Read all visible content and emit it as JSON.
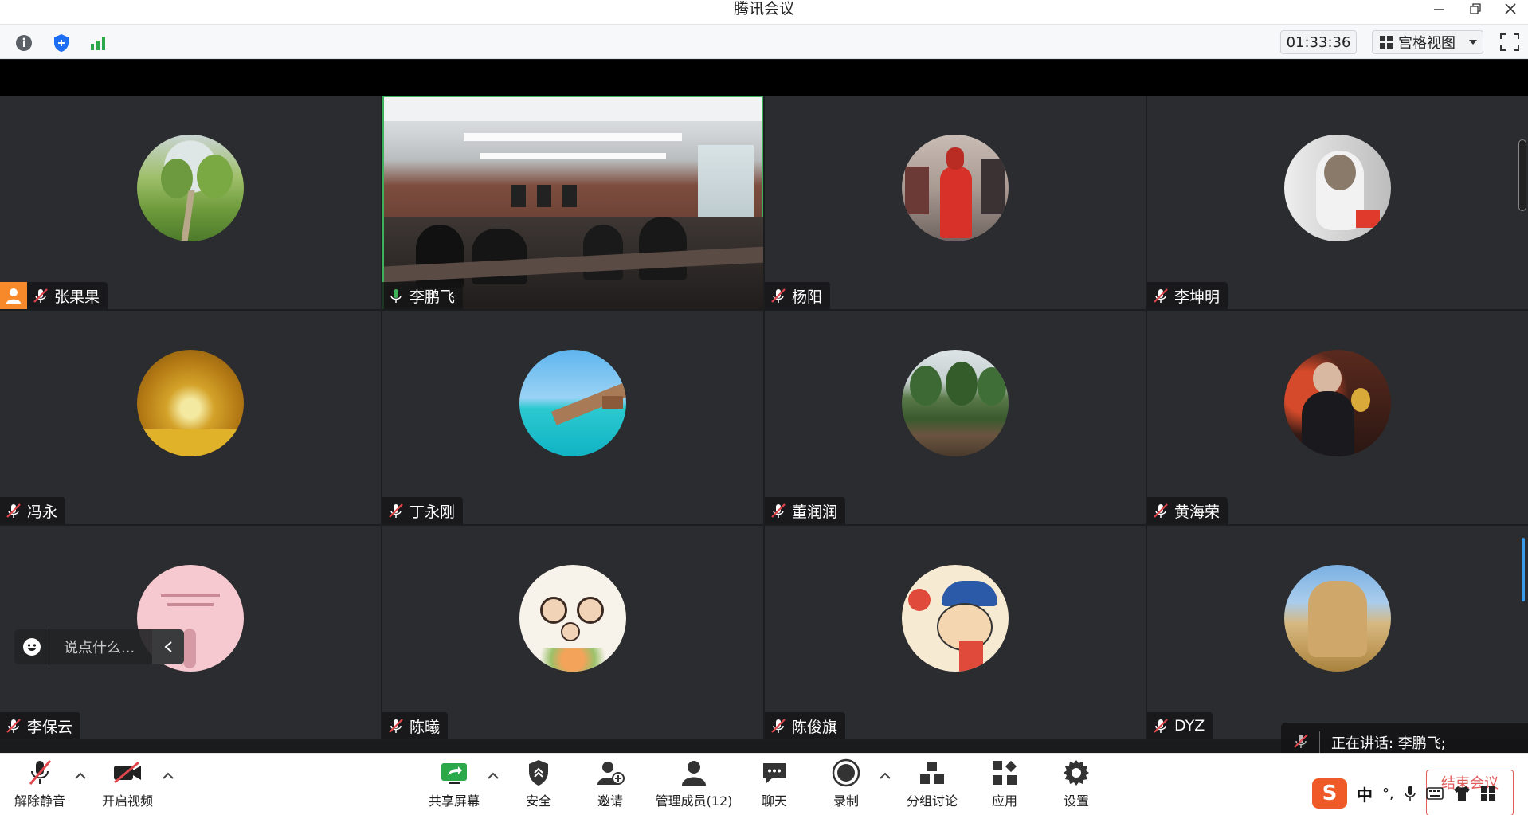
{
  "window": {
    "title": "腾讯会议"
  },
  "toolbar": {
    "timer": "01:33:36",
    "view_mode": "宫格视图"
  },
  "participants": [
    {
      "name": "张果果",
      "mic": "muted",
      "host": true,
      "avatar": "green-trail-photo"
    },
    {
      "name": "李鹏飞",
      "mic": "active",
      "video": true,
      "avatar": "conference-room-video"
    },
    {
      "name": "杨阳",
      "mic": "muted",
      "avatar": "red-jacket-photo"
    },
    {
      "name": "李坤明",
      "mic": "muted",
      "avatar": "cat-photo"
    },
    {
      "name": "冯永",
      "mic": "muted",
      "avatar": "golden-trees-photo"
    },
    {
      "name": "丁永刚",
      "mic": "muted",
      "avatar": "pier-sea-photo"
    },
    {
      "name": "董润润",
      "mic": "muted",
      "avatar": "tree-row-photo"
    },
    {
      "name": "黄海荣",
      "mic": "muted",
      "avatar": "man-trophy-photo"
    },
    {
      "name": "李保云",
      "mic": "muted",
      "avatar": "pink-card-image"
    },
    {
      "name": "陈曦",
      "mic": "muted",
      "avatar": "cartoon-family-image"
    },
    {
      "name": "陈俊旗",
      "mic": "muted",
      "avatar": "popeye-cartoon-image"
    },
    {
      "name": "DYZ",
      "mic": "muted",
      "avatar": "stone-monument-photo"
    }
  ],
  "chat": {
    "placeholder": "说点什么..."
  },
  "speaking": {
    "text": "正在讲话: 李鹏飞;"
  },
  "bottom": {
    "unmute": "解除静音",
    "start_video": "开启视频",
    "share_screen": "共享屏幕",
    "security": "安全",
    "invite": "邀请",
    "manage_members": "管理成员(12)",
    "chat": "聊天",
    "record": "录制",
    "breakout": "分组讨论",
    "apps": "应用",
    "settings": "设置",
    "end_meeting": "结束会议"
  },
  "ime": {
    "lang": "中",
    "punct": "°,"
  },
  "colors": {
    "host_badge": "#f7892a",
    "active_border": "#3fb15a",
    "muted_red": "#e0474c",
    "brand_blue": "#1c6ef2"
  }
}
